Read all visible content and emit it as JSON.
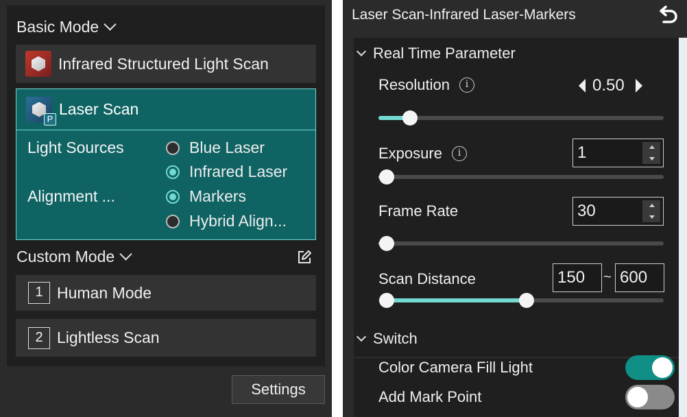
{
  "left": {
    "basic_mode_label": "Basic Mode",
    "infrared_item_label": "Infrared Structured Light Scan",
    "laser_item_label": "Laser Scan",
    "laser_badge": "P",
    "light_sources_label": "Light Sources",
    "alignment_label": "Alignment ...",
    "light_sources_options": [
      {
        "label": "Blue Laser",
        "selected": false
      },
      {
        "label": "Infrared Laser",
        "selected": true
      }
    ],
    "alignment_options": [
      {
        "label": "Markers",
        "selected": true
      },
      {
        "label": "Hybrid Align...",
        "selected": false
      }
    ],
    "custom_mode_label": "Custom Mode",
    "custom_items": [
      {
        "number": "1",
        "label": "Human Mode"
      },
      {
        "number": "2",
        "label": "Lightless Scan"
      }
    ],
    "settings_label": "Settings"
  },
  "right": {
    "title": "Laser Scan-Infrared Laser-Markers",
    "real_time_section": "Real Time Parameter",
    "resolution": {
      "label": "Resolution",
      "value": "0.50",
      "fraction": 0.11
    },
    "exposure": {
      "label": "Exposure",
      "value": "1",
      "fraction": 0.03
    },
    "frame_rate": {
      "label": "Frame Rate",
      "value": "30",
      "fraction": 0.03
    },
    "scan_distance": {
      "label": "Scan Distance",
      "min": "150",
      "separator": "~",
      "max": "600",
      "min_fraction": 0.03,
      "max_fraction": 0.52
    },
    "switch_section": "Switch",
    "color_camera": {
      "label": "Color Camera Fill Light",
      "on": true
    },
    "add_mark_point": {
      "label": "Add Mark Point",
      "on": false
    }
  },
  "colors": {
    "accent": "#74d9d2",
    "selected_panel": "#0f6363",
    "toggle_on": "#0f8f86",
    "toggle_off": "#8a8a8a"
  }
}
